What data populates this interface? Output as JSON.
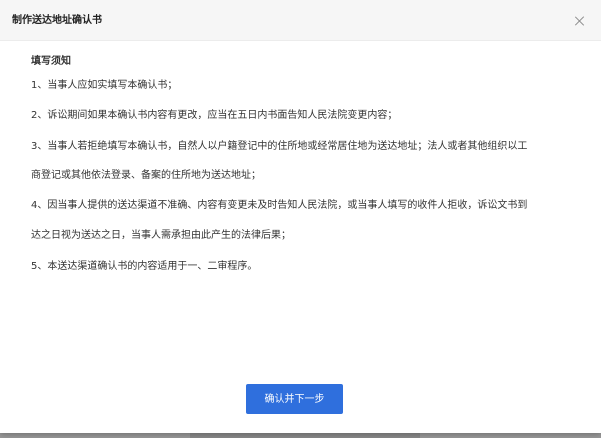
{
  "dialog": {
    "title": "制作送达地址确认书",
    "close_icon": "close-icon"
  },
  "notice": {
    "heading": "填写须知",
    "lines": [
      "1、当事人应如实填写本确认书；",
      "2、诉讼期间如果本确认书内容有更改，应当在五日内书面告知人民法院变更内容；",
      "3、当事人若拒绝填写本确认书，自然人以户籍登记中的住所地或经常居住地为送达地址；法人或者其他组织以工",
      "商登记或其他依法登录、备案的住所地为送达地址；",
      "4、因当事人提供的送达渠道不准确、内容有变更未及时告知人民法院，或当事人填写的收件人拒收，诉讼文书到",
      "达之日视为送达之日，当事人需承担由此产生的法律后果；",
      "5、本送达渠道确认书的内容适用于一、二审程序。"
    ]
  },
  "footer": {
    "confirm_label": "确认并下一步"
  },
  "colors": {
    "primary_button": "#2f6fdd",
    "header_bg": "#f6f6f6",
    "overlay": "#9a9a9a"
  }
}
